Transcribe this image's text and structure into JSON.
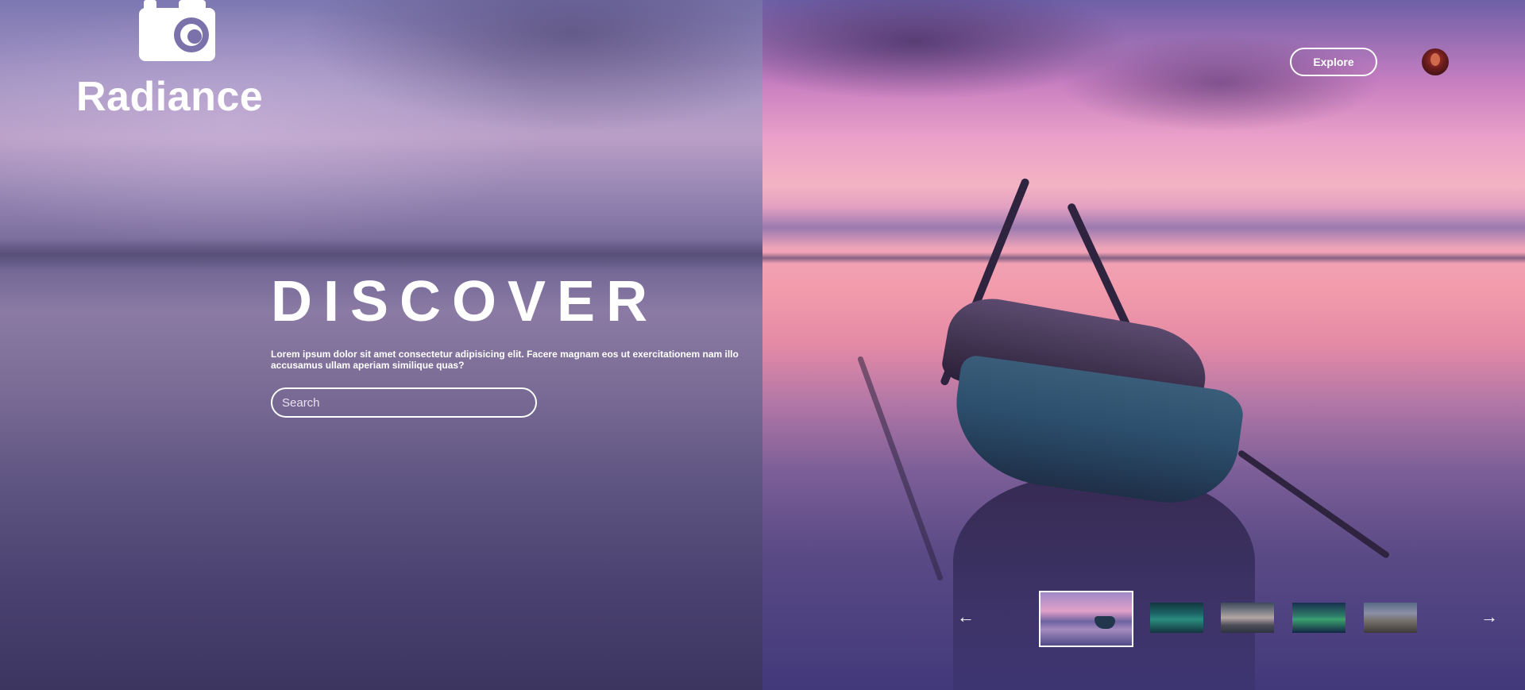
{
  "brand": {
    "name": "Radiance",
    "icon": "camera-icon"
  },
  "hero": {
    "title": "DISCOVER",
    "description": "Lorem ipsum dolor sit amet consectetur adipisicing elit. Facere magnam eos ut exercitationem nam illo accusamus ullam aperiam similique quas?",
    "search_placeholder": "Search"
  },
  "header": {
    "explore_label": "Explore",
    "avatar": "user-avatar"
  },
  "carousel": {
    "prev_icon": "←",
    "next_icon": "→",
    "selected_index": 0,
    "thumbnails": [
      "boat-at-sunset",
      "aurora-over-lake",
      "cloudy-shore",
      "aurora-night-sky",
      "mountain-valley"
    ]
  },
  "colors": {
    "text": "#ffffff",
    "accent_border": "#ffffff"
  }
}
